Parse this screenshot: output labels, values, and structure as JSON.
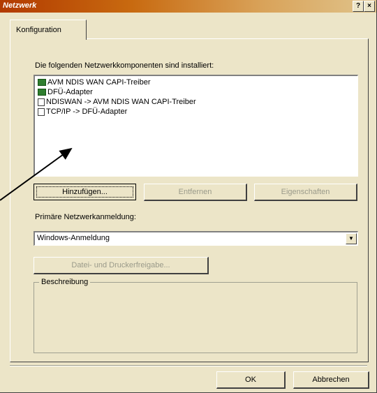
{
  "window": {
    "title": "Netzwerk"
  },
  "titlebar_buttons": {
    "help": "?",
    "close": "×"
  },
  "tabs": [
    {
      "label": "Konfiguration"
    }
  ],
  "installed_label": "Die folgenden Netzwerkkomponenten sind installiert:",
  "components": [
    {
      "label": "AVM NDIS WAN CAPI-Treiber",
      "icon": "network-adapter-icon"
    },
    {
      "label": "DFÜ-Adapter",
      "icon": "network-adapter-icon"
    },
    {
      "label": "NDISWAN -> AVM NDIS WAN CAPI-Treiber",
      "icon": "protocol-icon"
    },
    {
      "label": "TCP/IP -> DFÜ-Adapter",
      "icon": "protocol-icon"
    }
  ],
  "buttons": {
    "add": "Hinzufügen...",
    "remove": "Entfernen",
    "properties": "Eigenschaften",
    "file_print_sharing": "Datei- und Druckerfreigabe...",
    "ok": "OK",
    "cancel": "Abbrechen"
  },
  "primary_logon_label": "Primäre Netzwerkanmeldung:",
  "primary_logon_value": "Windows-Anmeldung",
  "description_label": "Beschreibung",
  "colors": {
    "dialog_bg": "#ece5c8",
    "title_start": "#b23a00",
    "title_end": "#e0c48c"
  }
}
